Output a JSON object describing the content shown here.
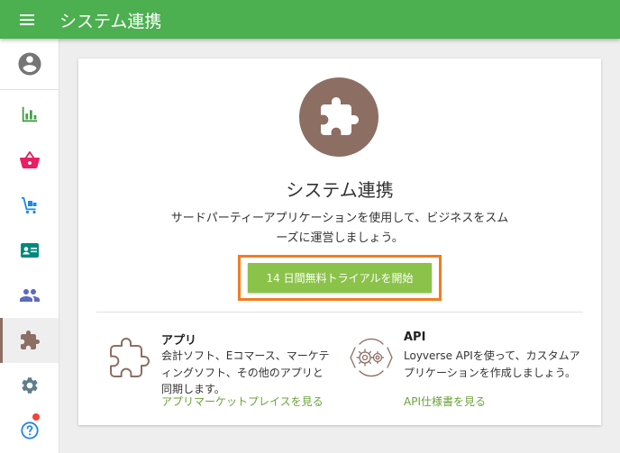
{
  "header": {
    "title": "システム連携"
  },
  "card": {
    "title": "システム連携",
    "description": "サードパーティーアプリケーションを使用して、ビジネスをスムーズに運営しましょう。",
    "trial_button": "14 日間無料トライアルを開始"
  },
  "features": {
    "apps": {
      "title": "アプリ",
      "text": "会計ソフト、Eコマース、マーケティングソフト、その他のアプリと同期します。",
      "link": "アプリマーケットプレイスを見る"
    },
    "api": {
      "title": "API",
      "text": "Loyverse APIを使って、カスタムアプリケーションを作成しましょう。",
      "link": "API仕様書を見る"
    }
  },
  "colors": {
    "topbar": "#4caf50",
    "accent_brown": "#8d6e63",
    "trial_button": "#8bc34a",
    "highlight_border": "#ef7d22",
    "link": "#6ba23a"
  },
  "sidebar": {
    "items": [
      {
        "icon": "account-circle-icon"
      },
      {
        "icon": "bar-chart-icon"
      },
      {
        "icon": "shopping-basket-icon"
      },
      {
        "icon": "inventory-cart-icon"
      },
      {
        "icon": "employee-card-icon"
      },
      {
        "icon": "customers-icon"
      },
      {
        "icon": "puzzle-icon",
        "active": true
      },
      {
        "icon": "gear-icon"
      },
      {
        "icon": "help-icon"
      }
    ]
  }
}
